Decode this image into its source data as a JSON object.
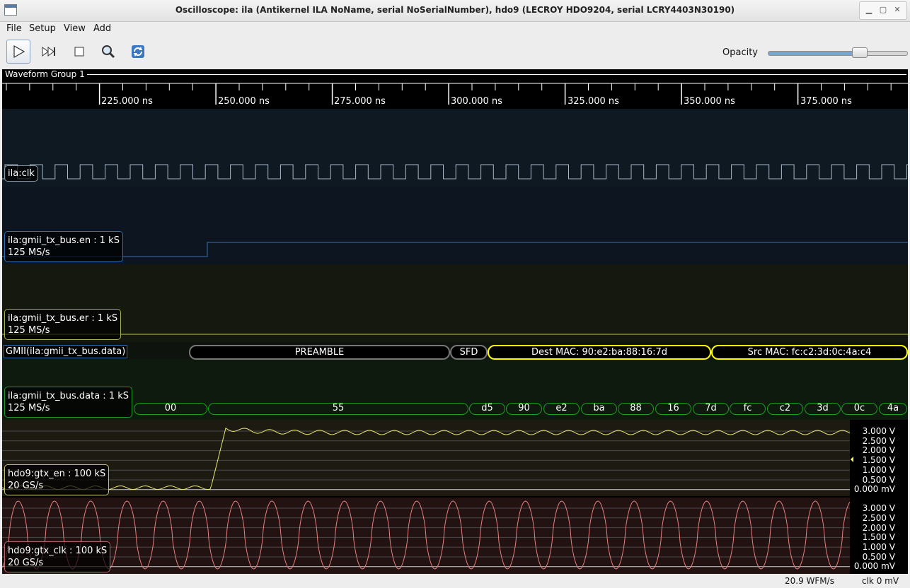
{
  "window": {
    "title": "Oscilloscope: ila (Antikernel ILA NoName, serial NoSerialNumber), hdo9 (LECROY HDO9204, serial LCRY4403N30190)"
  },
  "menu": [
    "File",
    "Setup",
    "View",
    "Add"
  ],
  "toolbar": {
    "buttons": [
      "play-icon",
      "step-forward-icon",
      "stop-icon",
      "zoom-icon",
      "refresh-icon"
    ],
    "opacity_label": "Opacity",
    "opacity_value": 0.66
  },
  "group": {
    "name": "Waveform Group 1"
  },
  "timeline": {
    "ticks": [
      "225.000 ns",
      "250.000 ns",
      "275.000 ns",
      "300.000 ns",
      "325.000 ns",
      "350.000 ns",
      "375.000 ns"
    ]
  },
  "channels": {
    "clk": {
      "name": "ila:clk"
    },
    "en": {
      "name": "ila:gmii_tx_bus.en : 1 kS",
      "rate": "125 MS/s"
    },
    "er": {
      "name": "ila:gmii_tx_bus.er : 1 kS",
      "rate": "125 MS/s"
    },
    "decoder": {
      "name": "GMII(ila:gmii_tx_bus.data)"
    },
    "data": {
      "name": "ila:gmii_tx_bus.data : 1 kS",
      "rate": "125 MS/s"
    },
    "gtx_en": {
      "name": "hdo9:gtx_en : 100 kS",
      "rate": "20 GS/s"
    },
    "gtx_clk": {
      "name": "hdo9:gtx_clk : 100 kS",
      "rate": "20 GS/s"
    }
  },
  "packets": [
    "PREAMBLE",
    "SFD",
    "Dest MAC: 90:e2:ba:88:16:7d",
    "Src MAC: fc:c2:3d:0c:4a:c4"
  ],
  "bytes": [
    "00",
    "55",
    "d5",
    "90",
    "e2",
    "ba",
    "88",
    "16",
    "7d",
    "fc",
    "c2",
    "3d",
    "0c",
    "4a"
  ],
  "volt_scale": [
    "3.000 V",
    "2.500 V",
    "2.000 V",
    "1.500 V",
    "1.000 V",
    "0.500 V",
    "0.000 mV"
  ],
  "volt_scale2": [
    "3.000 V",
    "2.500 V",
    "2.000 V",
    "1.500 V",
    "1.000 V",
    "0.500 V",
    "0.000 mV"
  ],
  "status": {
    "wfm_rate": "20.9 WFM/s",
    "clk": "clk 0 mV"
  }
}
